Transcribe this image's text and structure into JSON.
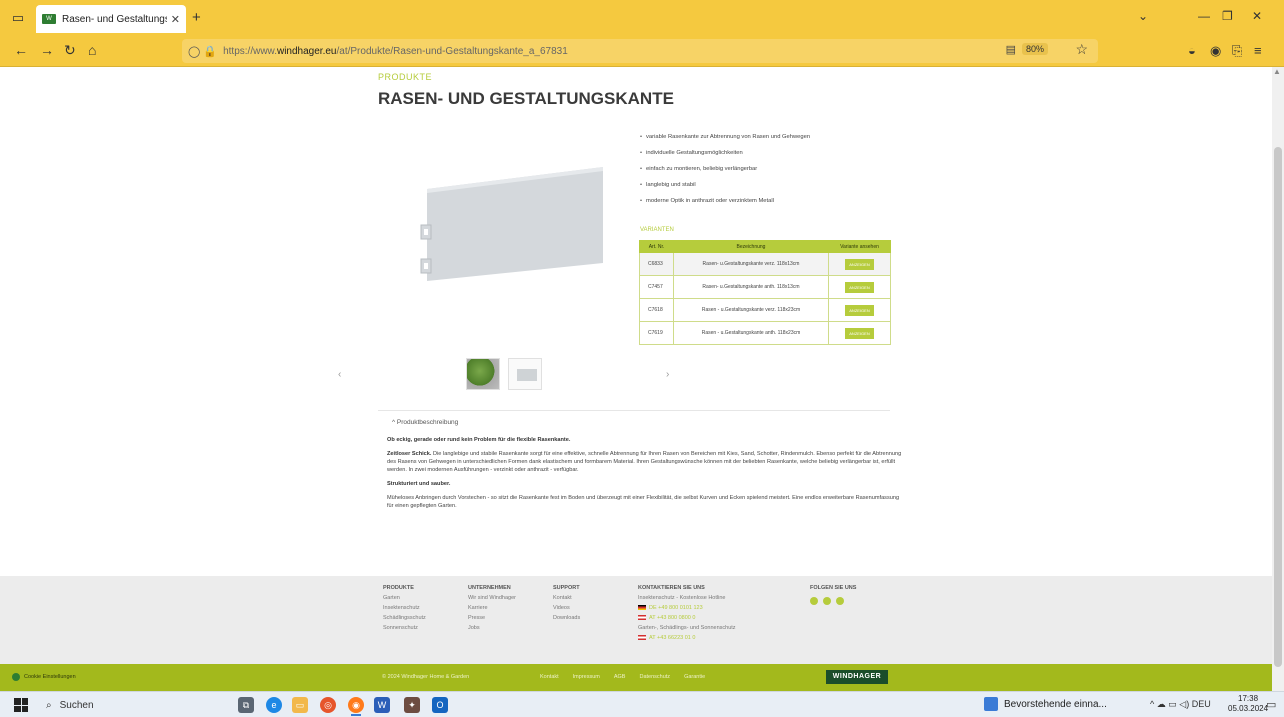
{
  "browser": {
    "tab_title": "Rasen- und Gestaltungskante |",
    "url_prefix": "https://www.",
    "url_host": "windhager.eu",
    "url_path": "/at/Produkte/Rasen-und-Gestaltungskante_a_67831",
    "zoom": "80%"
  },
  "product": {
    "breadcrumb": "PRODUKTE",
    "title": "RASEN- UND GESTALTUNGSKANTE",
    "features": [
      "variable Rasenkante zur Abtrennung von Rasen und Gehwegen",
      "individuelle Gestaltungsmöglichkeiten",
      "einfach zu montieren, beliebig verlängerbar",
      "langlebig und stabil",
      "moderne Optik in anthrazit oder verzinktem Metall"
    ],
    "variants_label": "VARIANTEN",
    "table_headers": [
      "Art. Nr.",
      "Bezeichnung",
      "Variante ansehen"
    ],
    "variants": [
      {
        "art": "C6833",
        "name": "Rasen- u.Gestaltungskante verz. 118x13cm",
        "action": "ANZEIGEN"
      },
      {
        "art": "C7457",
        "name": "Rasen- u.Gestaltungskante anth. 118x13cm",
        "action": "ANZEIGEN"
      },
      {
        "art": "C7618",
        "name": "Rasen - u.Gestaltungskante verz. 118x23cm",
        "action": "ANZEIGEN"
      },
      {
        "art": "C7619",
        "name": "Rasen - u.Gestaltungskante anth. 118x23cm",
        "action": "ANZEIGEN"
      }
    ],
    "desc_toggle": "Produktbeschreibung",
    "desc_heading": "Ob eckig, gerade oder rund kein Problem für die flexible Rasenkante.",
    "desc_p1_lead": "Zeitloser Schick.",
    "desc_p1": " Die langlebige und stabile Rasenkante sorgt für eine effektive, schnelle Abtrennung für Ihren Rasen von Bereichen mit Kies, Sand, Schotter, Rindenmulch. Ebenso perfekt für die Abtrennung des Rasens von Gehwegen in unterschiedlichen Formen dank elastischem und formbarem Material. Ihren Gestaltungswünsche können mit der beliebten Rasenkante, welche beliebig verlängerbar ist, erfüllt werden. In zwei modernen Ausführungen - verzinkt oder anthrazit - verfügbar.",
    "desc_sub": "Strukturiert und sauber.",
    "desc_p2": "Müheloses Anbringen durch Vorstechen - so sitzt die Rasenkante fest im Boden und überzeugt mit einer Flexibilität, die selbst Kurven und Ecken spielend meistert. Eine endlos erweiterbare Rasenumfassung für einen gepflegten Garten."
  },
  "footer": {
    "col1": {
      "head": "PRODUKTE",
      "items": [
        "Garten",
        "Insektenschutz",
        "Schädlingsschutz",
        "Sonnenschutz"
      ]
    },
    "col2": {
      "head": "UNTERNEHMEN",
      "items": [
        "Wir sind Windhager",
        "Karriere",
        "Presse",
        "Jobs"
      ]
    },
    "col3": {
      "head": "SUPPORT",
      "items": [
        "Kontakt",
        "Videos",
        "Downloads"
      ]
    },
    "contact": {
      "head": "KONTAKTIEREN SIE UNS",
      "line1": "Insektenschutz - Kostenlose Hotline",
      "phone_de": "DE +49 800 0101 123",
      "phone_at1": "AT +43 800 0800 0",
      "line2": "Garten-, Schädlings- und Sonnenschutz",
      "phone_at2": "AT +43 66223 01 0"
    },
    "social_head": "FOLGEN SIE UNS",
    "cookie": "Cookie Einstellungen",
    "copyright": "© 2024 Windhager Home & Garden",
    "links": [
      "Kontakt",
      "Impressum",
      "AGB",
      "Datenschutz",
      "Garantie"
    ],
    "logo": "WINDHAGER"
  },
  "taskbar": {
    "search": "Suchen",
    "notification": "Bevorstehende einna...",
    "lang": "DEU",
    "time": "17:38",
    "date": "05.03.2024"
  }
}
